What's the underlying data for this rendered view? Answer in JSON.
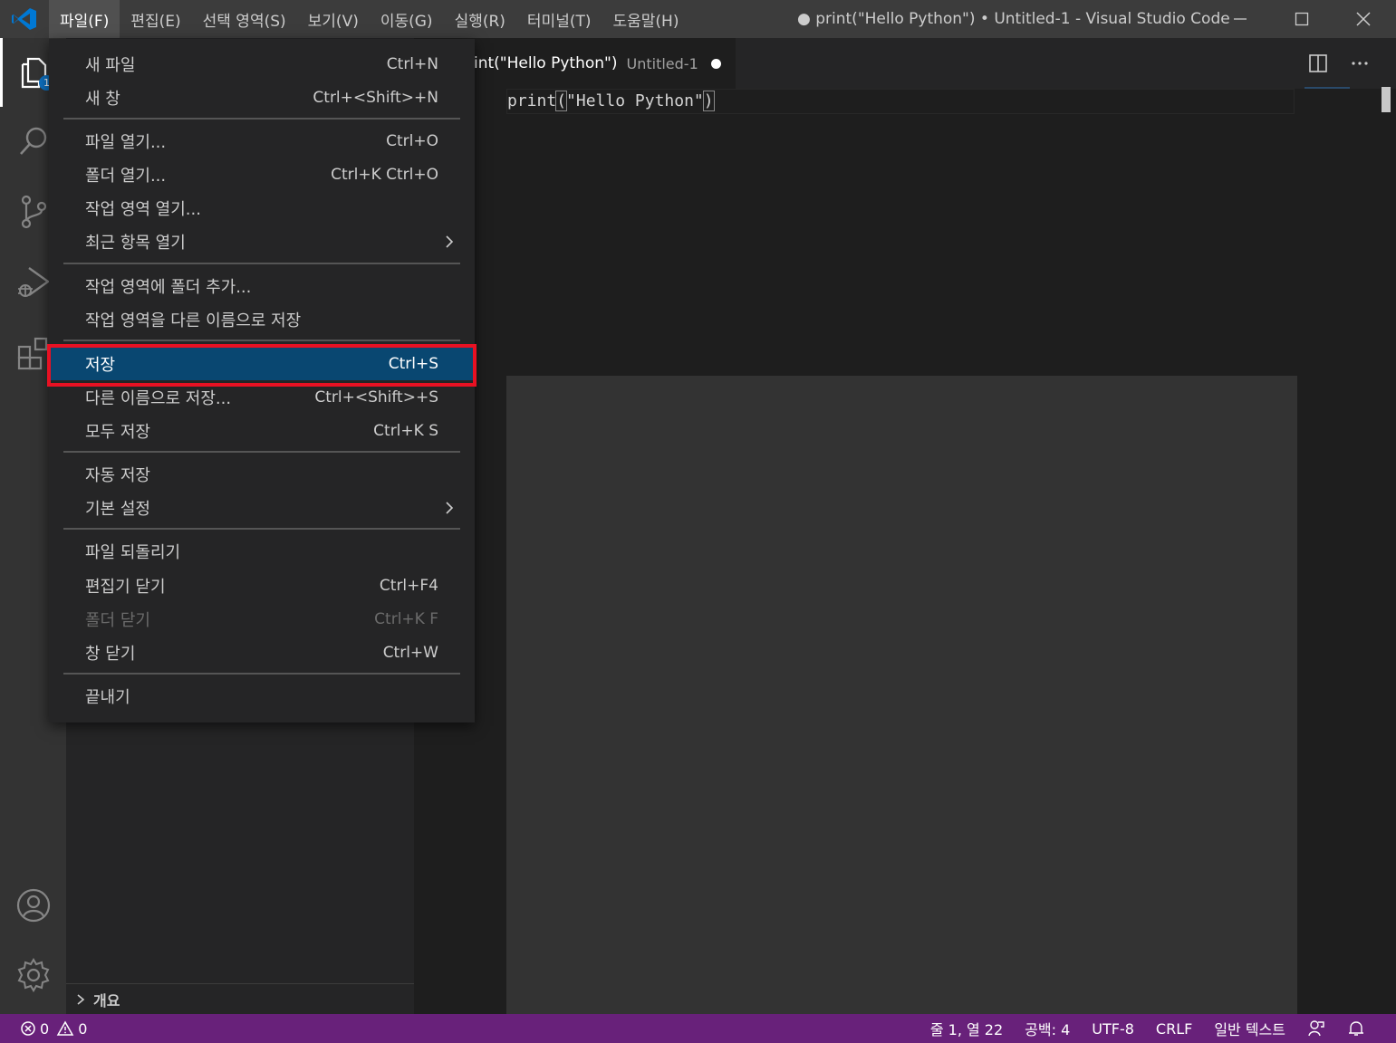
{
  "menubar": {
    "items": [
      "파일(F)",
      "편집(E)",
      "선택 영역(S)",
      "보기(V)",
      "이동(G)",
      "실행(R)",
      "터미널(T)",
      "도움말(H)"
    ]
  },
  "window": {
    "title": "● print(\"Hello Python\") • Untitled-1 - Visual Studio Code"
  },
  "activity": {
    "explorer_badge": "1"
  },
  "editor": {
    "tab_title": "int(\"Hello Python\")",
    "tab_desc": "Untitled-1",
    "code_fn": "print",
    "code_open": "(",
    "code_str": "\"Hello Python\"",
    "code_close": ")"
  },
  "sidebar": {
    "outline_label": "개요"
  },
  "file_menu": {
    "items": [
      {
        "label": "새 파일",
        "key": "Ctrl+N"
      },
      {
        "label": "새 창",
        "key": "Ctrl+<Shift>+N"
      },
      {
        "label": "파일 열기...",
        "key": "Ctrl+O"
      },
      {
        "label": "폴더 열기...",
        "key": "Ctrl+K Ctrl+O"
      },
      {
        "label": "작업 영역 열기...",
        "key": ""
      },
      {
        "label": "최근 항목 열기",
        "key": ""
      },
      {
        "label": "작업 영역에 폴더 추가...",
        "key": ""
      },
      {
        "label": "작업 영역을 다른 이름으로 저장",
        "key": ""
      },
      {
        "label": "저장",
        "key": "Ctrl+S"
      },
      {
        "label": "다른 이름으로 저장...",
        "key": "Ctrl+<Shift>+S"
      },
      {
        "label": "모두 저장",
        "key": "Ctrl+K S"
      },
      {
        "label": "자동 저장",
        "key": ""
      },
      {
        "label": "기본 설정",
        "key": ""
      },
      {
        "label": "파일 되돌리기",
        "key": ""
      },
      {
        "label": "편집기 닫기",
        "key": "Ctrl+F4"
      },
      {
        "label": "폴더 닫기",
        "key": "Ctrl+K F"
      },
      {
        "label": "창 닫기",
        "key": "Ctrl+W"
      },
      {
        "label": "끝내기",
        "key": ""
      }
    ]
  },
  "status": {
    "errors": "0",
    "warnings": "0",
    "position": "줄 1, 열 22",
    "indent": "공백: 4",
    "encoding": "UTF-8",
    "eol": "CRLF",
    "language": "일반 텍스트"
  },
  "colors": {
    "statusbar": "#68217a",
    "menu_selected": "#094771",
    "highlight": "#e81123",
    "badge": "#0e70c0"
  }
}
